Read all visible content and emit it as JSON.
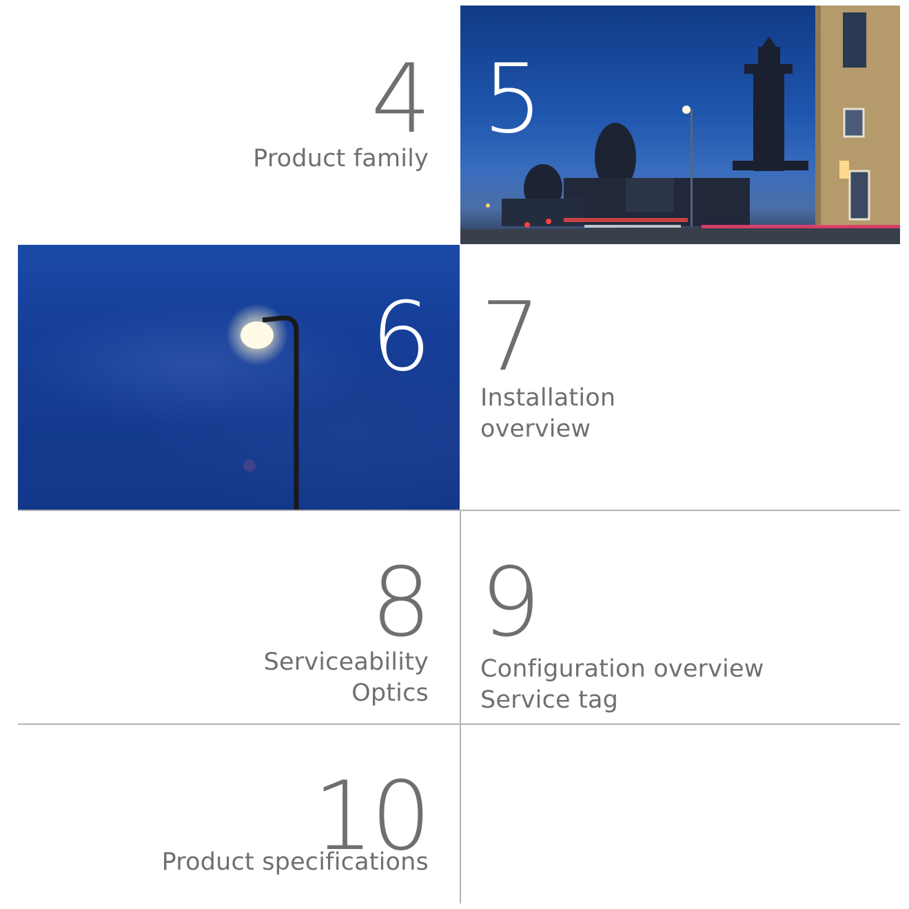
{
  "tiles": [
    {
      "number": "4",
      "label_lines": [
        "Product family"
      ]
    },
    {
      "number": "5",
      "label_lines": []
    },
    {
      "number": "6",
      "label_lines": []
    },
    {
      "number": "7",
      "label_lines": [
        "Installation",
        "overview"
      ]
    },
    {
      "number": "8",
      "label_lines": [
        "Serviceability",
        "Optics"
      ]
    },
    {
      "number": "9",
      "label_lines": [
        "Configuration overview",
        "Service tag"
      ]
    },
    {
      "number": "10",
      "label_lines": [
        "Product specifications"
      ]
    }
  ],
  "colors": {
    "text": "#6f6f6f",
    "divider": "#b3b3b3",
    "photo_number": "#ffffff"
  }
}
